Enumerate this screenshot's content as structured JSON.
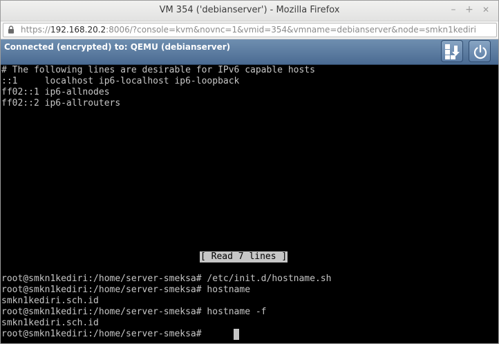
{
  "window": {
    "title": "VM 354 ('debianserver') - Mozilla Firefox",
    "minimize_glyph": "–",
    "maximize_glyph": "+",
    "close_glyph": "✕"
  },
  "urlbar": {
    "prefix": "https://",
    "host": "192.168.20.2",
    "rest": ":8006/?console=kvm&novnc=1&vmid=354&vmname=debianserver&node=smkn1kediri",
    "lock_icon": "lock-icon"
  },
  "novnc": {
    "status": "Connected (encrypted) to: QEMU (debianserver)",
    "status_color": "#ffffff",
    "bar_color": "#5b7ca1",
    "buttons": [
      {
        "name": "send-keys-icon"
      },
      {
        "name": "power-icon"
      }
    ]
  },
  "terminal": {
    "lines_top": [
      "# The following lines are desirable for IPv6 capable hosts",
      "::1     localhost ip6-localhost ip6-loopback",
      "ff02::1 ip6-allnodes",
      "ff02::2 ip6-allrouters"
    ],
    "status_message": "[ Read 7 lines ]",
    "lines_bottom": [
      "root@smkn1kediri:/home/server-smeksa# /etc/init.d/hostname.sh",
      "root@smkn1kediri:/home/server-smeksa# hostname",
      "smkn1kediri.sch.id",
      "root@smkn1kediri:/home/server-smeksa# hostname -f",
      "smkn1kediri.sch.id",
      "root@smkn1kediri:/home/server-smeksa#"
    ],
    "text_color": "#c6c6c6",
    "background": "#000000"
  }
}
